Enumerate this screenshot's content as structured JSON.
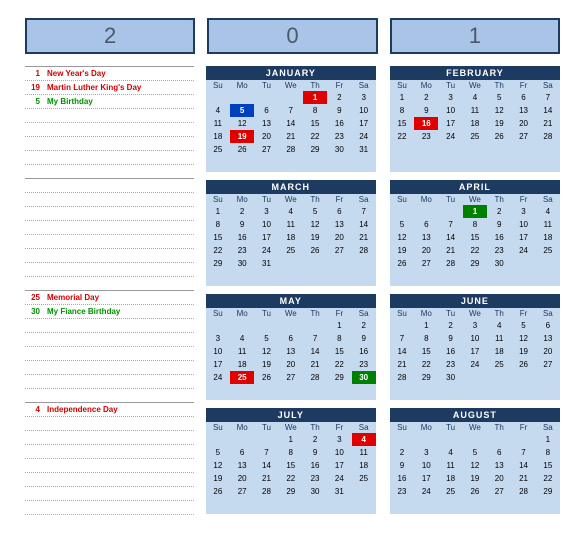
{
  "year": {
    "d0": "2",
    "d1": "0",
    "d2": "1"
  },
  "dow": [
    "Su",
    "Mo",
    "Tu",
    "We",
    "Th",
    "Fr",
    "Sa"
  ],
  "blocks": [
    {
      "events": [
        {
          "date": "1",
          "text": "New Year's Day",
          "color": "red"
        },
        {
          "date": "19",
          "text": "Martin Luther King's Day",
          "color": "red"
        },
        {
          "date": "5",
          "text": "My Birthday",
          "color": "green"
        }
      ]
    },
    {
      "events": []
    },
    {
      "events": [
        {
          "date": "25",
          "text": "Memorial Day",
          "color": "red"
        },
        {
          "date": "30",
          "text": "My Fiance Birthday",
          "color": "green"
        }
      ]
    },
    {
      "events": [
        {
          "date": "4",
          "text": "Independence Day",
          "color": "red"
        }
      ]
    }
  ],
  "months": [
    {
      "name": "JANUARY",
      "weeks": [
        [
          "",
          "",
          "",
          "",
          "1",
          "2",
          "3"
        ],
        [
          "4",
          "5",
          "6",
          "7",
          "8",
          "9",
          "10"
        ],
        [
          "11",
          "12",
          "13",
          "14",
          "15",
          "16",
          "17"
        ],
        [
          "18",
          "19",
          "20",
          "21",
          "22",
          "23",
          "24"
        ],
        [
          "25",
          "26",
          "27",
          "28",
          "29",
          "30",
          "31"
        ]
      ],
      "hl": {
        "1": "red",
        "5": "blue",
        "19": "red"
      }
    },
    {
      "name": "FEBRUARY",
      "weeks": [
        [
          "1",
          "2",
          "3",
          "4",
          "5",
          "6",
          "7"
        ],
        [
          "8",
          "9",
          "10",
          "11",
          "12",
          "13",
          "14"
        ],
        [
          "15",
          "16",
          "17",
          "18",
          "19",
          "20",
          "21"
        ],
        [
          "22",
          "23",
          "24",
          "25",
          "26",
          "27",
          "28"
        ],
        [
          "",
          "",
          "",
          "",
          "",
          "",
          ""
        ]
      ],
      "hl": {
        "16": "red"
      }
    },
    {
      "name": "MARCH",
      "weeks": [
        [
          "1",
          "2",
          "3",
          "4",
          "5",
          "6",
          "7"
        ],
        [
          "8",
          "9",
          "10",
          "11",
          "12",
          "13",
          "14"
        ],
        [
          "15",
          "16",
          "17",
          "18",
          "19",
          "20",
          "21"
        ],
        [
          "22",
          "23",
          "24",
          "25",
          "26",
          "27",
          "28"
        ],
        [
          "29",
          "30",
          "31",
          "",
          "",
          "",
          ""
        ]
      ],
      "hl": {}
    },
    {
      "name": "APRIL",
      "weeks": [
        [
          "",
          "",
          "",
          "1",
          "2",
          "3",
          "4"
        ],
        [
          "5",
          "6",
          "7",
          "8",
          "9",
          "10",
          "11"
        ],
        [
          "12",
          "13",
          "14",
          "15",
          "16",
          "17",
          "18"
        ],
        [
          "19",
          "20",
          "21",
          "22",
          "23",
          "24",
          "25"
        ],
        [
          "26",
          "27",
          "28",
          "29",
          "30",
          "",
          ""
        ]
      ],
      "hl": {
        "1": "green"
      }
    },
    {
      "name": "MAY",
      "weeks": [
        [
          "",
          "",
          "",
          "",
          "",
          "1",
          "2"
        ],
        [
          "3",
          "4",
          "5",
          "6",
          "7",
          "8",
          "9"
        ],
        [
          "10",
          "11",
          "12",
          "13",
          "14",
          "15",
          "16"
        ],
        [
          "17",
          "18",
          "19",
          "20",
          "21",
          "22",
          "23"
        ],
        [
          "24",
          "25",
          "26",
          "27",
          "28",
          "29",
          "30"
        ]
      ],
      "hl": {
        "25": "red",
        "30": "green"
      }
    },
    {
      "name": "JUNE",
      "weeks": [
        [
          "",
          "1",
          "2",
          "3",
          "4",
          "5",
          "6"
        ],
        [
          "7",
          "8",
          "9",
          "10",
          "11",
          "12",
          "13"
        ],
        [
          "14",
          "15",
          "16",
          "17",
          "18",
          "19",
          "20"
        ],
        [
          "21",
          "22",
          "23",
          "24",
          "25",
          "26",
          "27"
        ],
        [
          "28",
          "29",
          "30",
          "",
          "",
          "",
          ""
        ]
      ],
      "hl": {}
    },
    {
      "name": "JULY",
      "weeks": [
        [
          "",
          "",
          "",
          "1",
          "2",
          "3",
          "4"
        ],
        [
          "5",
          "6",
          "7",
          "8",
          "9",
          "10",
          "11"
        ],
        [
          "12",
          "13",
          "14",
          "15",
          "16",
          "17",
          "18"
        ],
        [
          "19",
          "20",
          "21",
          "22",
          "23",
          "24",
          "25"
        ],
        [
          "26",
          "27",
          "28",
          "29",
          "30",
          "31",
          ""
        ]
      ],
      "hl": {
        "4": "red"
      }
    },
    {
      "name": "AUGUST",
      "weeks": [
        [
          "",
          "",
          "",
          "",
          "",
          "",
          "1"
        ],
        [
          "2",
          "3",
          "4",
          "5",
          "6",
          "7",
          "8"
        ],
        [
          "9",
          "10",
          "11",
          "12",
          "13",
          "14",
          "15"
        ],
        [
          "16",
          "17",
          "18",
          "19",
          "20",
          "21",
          "22"
        ],
        [
          "23",
          "24",
          "25",
          "26",
          "27",
          "28",
          "29"
        ]
      ],
      "hl": {}
    }
  ]
}
